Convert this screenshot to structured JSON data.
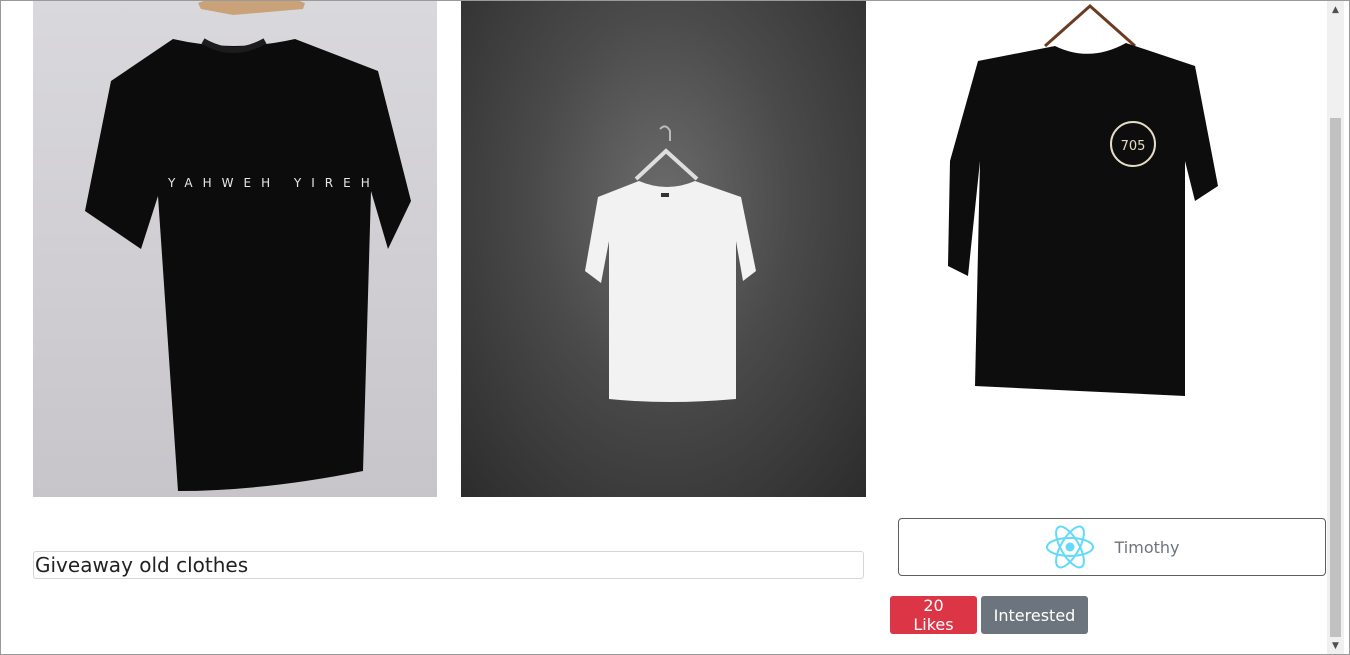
{
  "post": {
    "title": "Giveaway old clothes",
    "photos": [
      {
        "alt": "",
        "shirt_print": "YAHWEH  YIREH"
      },
      {
        "alt": ""
      },
      {
        "alt": "",
        "badge": "705"
      }
    ]
  },
  "owner": {
    "name": "Timothy",
    "avatar_icon": "react-atom-icon"
  },
  "actions": {
    "likes_label": "20 Likes",
    "interested_label": "Interested"
  },
  "colors": {
    "likes": "#dc3545",
    "interested": "#6c757d",
    "atom": "#61dafb"
  },
  "scrollbar": {
    "up_glyph": "▲",
    "down_glyph": "▼"
  }
}
